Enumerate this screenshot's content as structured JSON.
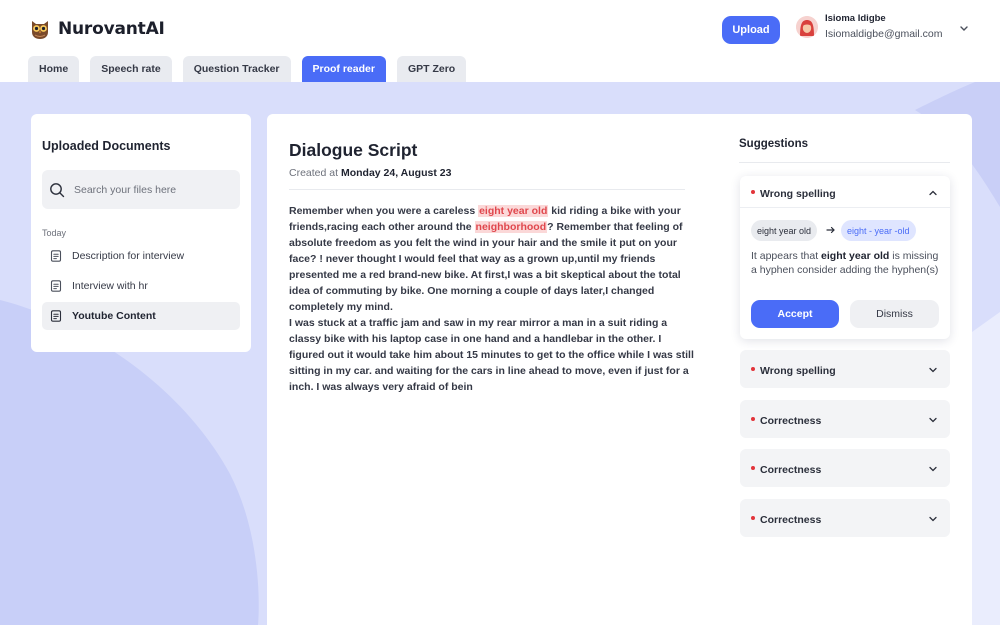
{
  "app": {
    "name": "NurovantAI"
  },
  "header": {
    "upload_label": "Upload",
    "user": {
      "name": "Isioma Idigbe",
      "email": "Isiomaldigbe@gmail.com"
    }
  },
  "tabs": [
    {
      "label": "Home",
      "active": false
    },
    {
      "label": "Speech rate",
      "active": false
    },
    {
      "label": "Question Tracker",
      "active": false
    },
    {
      "label": "Proof reader",
      "active": true
    },
    {
      "label": "GPT Zero",
      "active": false
    }
  ],
  "sidebar": {
    "title": "Uploaded Documents",
    "search_placeholder": "Search your files here",
    "group_label": "Today",
    "items": [
      {
        "label": "Description for interview",
        "active": false
      },
      {
        "label": "Interview with hr",
        "active": false
      },
      {
        "label": "Youtube Content",
        "active": true
      }
    ]
  },
  "document": {
    "title": "Dialogue Script",
    "created_prefix": "Created at",
    "created_date": "Monday 24, August 23",
    "paragraph1": [
      {
        "text": "Remember when you were a careless ",
        "highlight": false
      },
      {
        "text": "eight year old",
        "highlight": true
      },
      {
        "text": " kid riding a bike with your friends,racing each other around the ",
        "highlight": false
      },
      {
        "text": "neighborhood",
        "highlight": true
      },
      {
        "text": "? Remember that feeling of absolute freedom as you felt the wind in your hair and the smile it put on your face? ! never thought I would feel that way as a grown up,until my friends presented me a red brand-new bike. At first,I was a bit skeptical about the total idea of commuting by bike. One morning a couple of days later,I changed completely my mind.",
        "highlight": false
      }
    ],
    "paragraph2": "I was stuck at a traffic jam and saw in my rear mirror a man in a suit riding a classy bike with his laptop case in one hand and a handlebar in the other. I figured out it would take him about 15 minutes to get to the office while I was still sitting in my car. and waiting for the cars in line ahead to move, even if just for a inch. I was always very afraid of bein"
  },
  "suggestions": {
    "title": "Suggestions",
    "open": {
      "label": "Wrong spelling",
      "original": "eight year old",
      "replacement": "eight - year -old",
      "desc_before": "It appears that ",
      "desc_term": "eight year old",
      "desc_after": " is missing a hyphen consider adding the hyphen(s)",
      "accept_label": "Accept",
      "dismiss_label": "Dismiss"
    },
    "collapsed": [
      {
        "label": "Wrong spelling"
      },
      {
        "label": "Correctness"
      },
      {
        "label": "Correctness"
      },
      {
        "label": "Correctness"
      }
    ]
  },
  "colors": {
    "accent": "#4a6cf7",
    "background": "#d9defb",
    "error_dot": "#e2343a",
    "highlight_bg": "#fbd8d8",
    "highlight_text": "#e0474d"
  }
}
